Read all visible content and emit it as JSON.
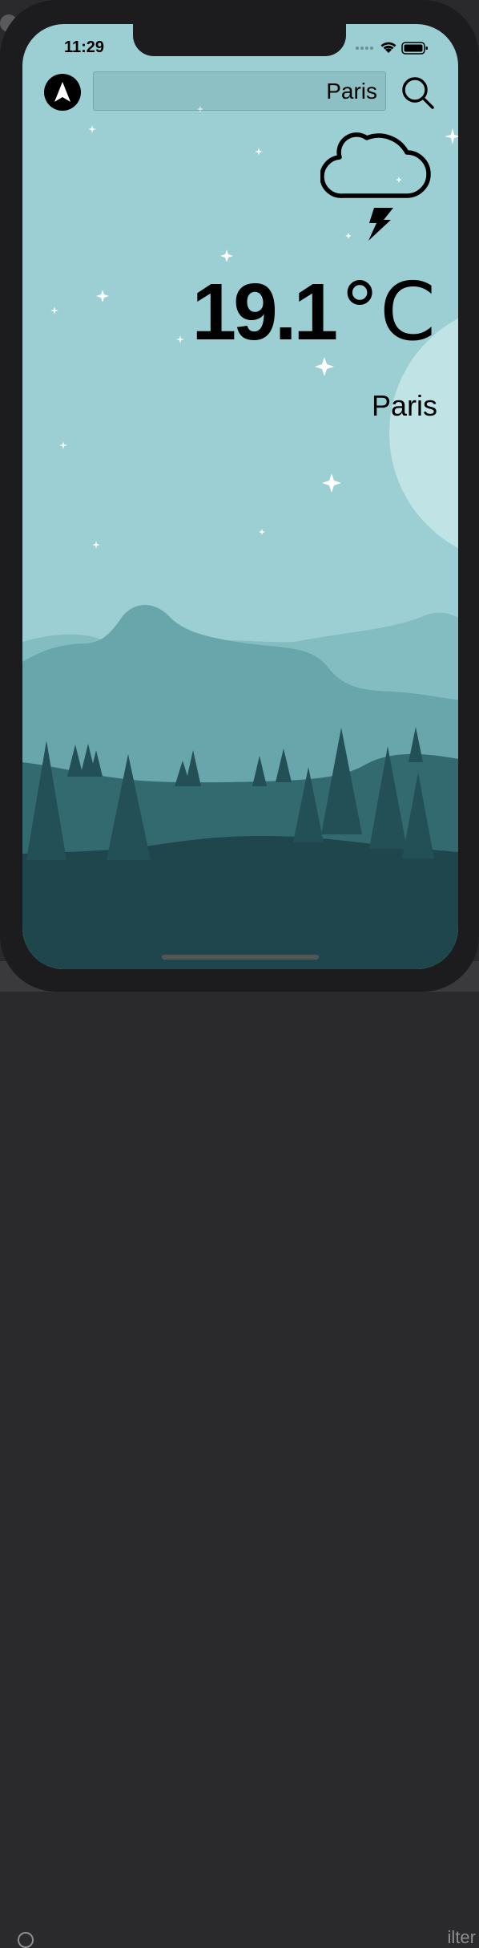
{
  "status_bar": {
    "time": "11:29"
  },
  "search": {
    "value": "Paris"
  },
  "weather": {
    "temperature": "19.1",
    "unit": "°C",
    "city": "Paris",
    "condition_icon": "thunderstorm-icon"
  },
  "icons": {
    "locate": "location-arrow-icon",
    "search": "search-icon",
    "signal": "cellular-signal-icon",
    "wifi": "wifi-icon",
    "battery": "battery-icon"
  },
  "colors": {
    "sky": "#9ccfd3",
    "moon": "#c0e3e6",
    "hill_far": "#83bdc1",
    "hill_mid": "#68a6ab",
    "hill_near": "#326a70",
    "ground": "#1f464d",
    "tree": "#234f56"
  },
  "background_app": {
    "filter_label": "ilter"
  }
}
